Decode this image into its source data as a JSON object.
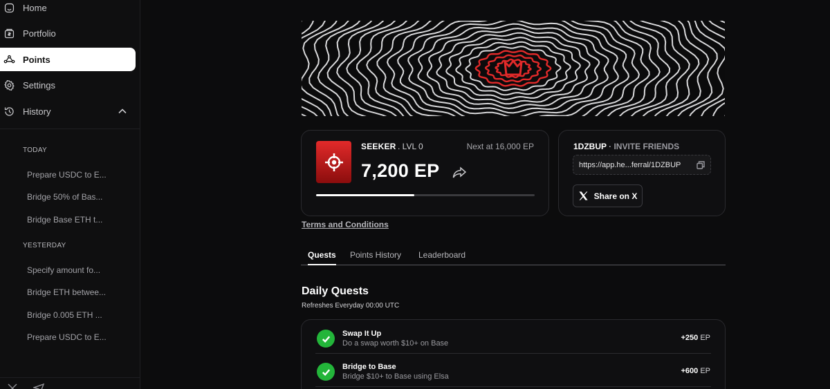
{
  "sidebar": {
    "nav": [
      {
        "label": "Home",
        "icon": "home-icon"
      },
      {
        "label": "Portfolio",
        "icon": "wallet-icon"
      },
      {
        "label": "Points",
        "icon": "nodes-icon"
      },
      {
        "label": "Settings",
        "icon": "gear-icon"
      },
      {
        "label": "History",
        "icon": "history-icon"
      }
    ],
    "active": "Points",
    "history": {
      "today_label": "TODAY",
      "today": [
        "Prepare USDC to E...",
        "Bridge 50% of Bas...",
        "Bridge Base ETH t..."
      ],
      "yesterday_label": "YESTERDAY",
      "yesterday": [
        "Specify amount fo...",
        "Bridge ETH betwee...",
        "Bridge 0.005 ETH ...",
        "Prepare USDC to E..."
      ]
    }
  },
  "level": {
    "name": "SEEKER",
    "level_text": ". LVL 0",
    "next_at": "Next at 16,000 EP",
    "points": "7,200 EP",
    "progress_fraction": 0.45,
    "badge_color": "#e22a2a"
  },
  "invite": {
    "code": "1DZBUP",
    "label": " · INVITE FRIENDS",
    "referral_link": "https://app.he...ferral/1DZBUP",
    "share_label": "Share on X"
  },
  "terms_label": "Terms and Conditions",
  "tabs": [
    "Quests",
    "Points History",
    "Leaderboard"
  ],
  "active_tab": "Quests",
  "daily": {
    "title": "Daily Quests",
    "subtitle": "Refreshes Everyday 00:00 UTC",
    "quests": [
      {
        "title": "Swap It Up",
        "desc": "Do a swap worth $10+ on Base",
        "points": "+250",
        "unit": "EP"
      },
      {
        "title": "Bridge to Base",
        "desc": "Bridge $10+ to Base using Elsa",
        "points": "+600",
        "unit": "EP"
      }
    ]
  },
  "colors": {
    "background": "#0c0c0d",
    "accent_red": "#e22a2a",
    "check_green": "#23b53a"
  }
}
